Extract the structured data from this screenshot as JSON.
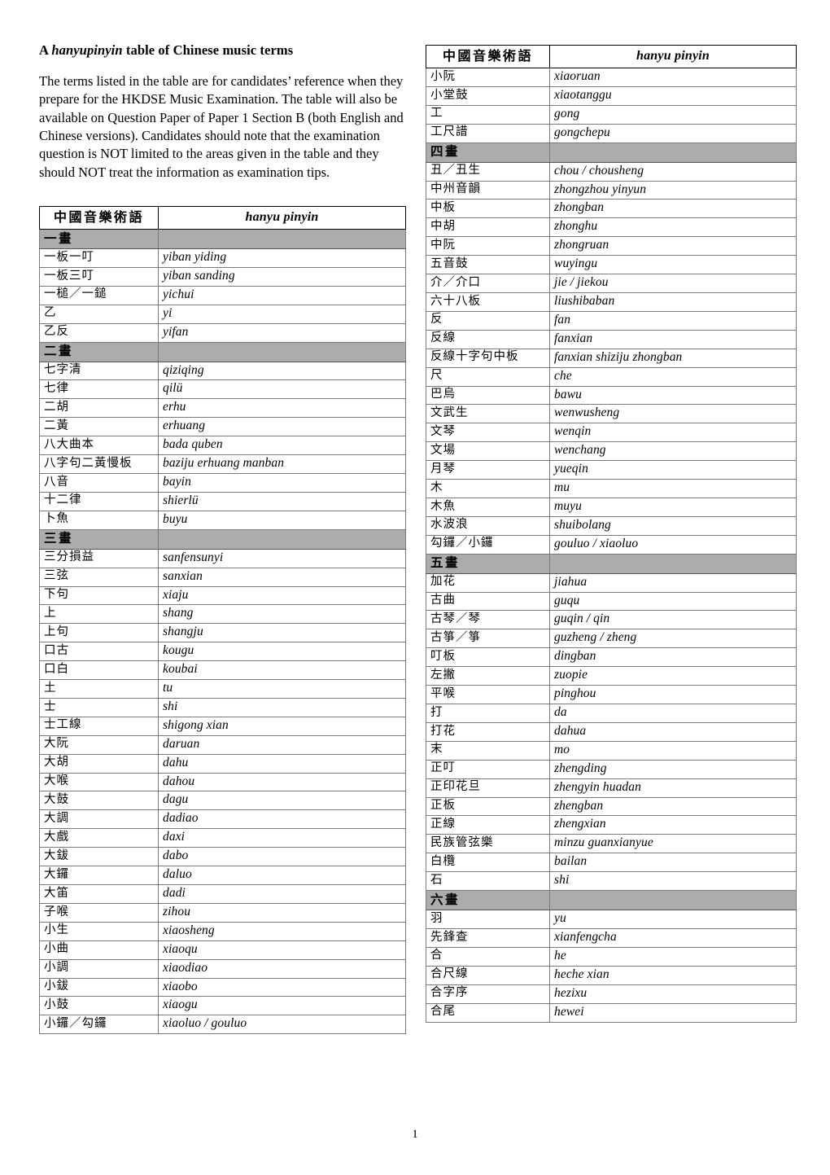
{
  "document": {
    "title_prefix": "A ",
    "title_italic": "hanyupinyin",
    "title_suffix": " table of Chinese music terms",
    "intro": "The terms listed in the table are for candidates’ reference when they prepare for the HKDSE Music Examination. The table will also be available on Question Paper of Paper 1 Section B (both English and Chinese versions). Candidates should note that the examination question is NOT limited to the areas given in the table and they should NOT treat the information as examination tips.",
    "page_number": "1"
  },
  "table_header": {
    "chinese": "中國音樂術語",
    "pinyin": "hanyu pinyin"
  },
  "left_table": {
    "rows": [
      {
        "type": "section",
        "zh": "一畫",
        "py": ""
      },
      {
        "type": "entry",
        "zh": "一板一叮",
        "py": "yiban yiding"
      },
      {
        "type": "entry",
        "zh": "一板三叮",
        "py": "yiban sanding"
      },
      {
        "type": "entry",
        "zh": "一槌／一鎚",
        "py": "yichui"
      },
      {
        "type": "entry",
        "zh": "乙",
        "py": "yi"
      },
      {
        "type": "entry",
        "zh": "乙反",
        "py": "yifan"
      },
      {
        "type": "section",
        "zh": "二畫",
        "py": ""
      },
      {
        "type": "entry",
        "zh": "七字清",
        "py": "qiziqing"
      },
      {
        "type": "entry",
        "zh": "七律",
        "py": "qilü"
      },
      {
        "type": "entry",
        "zh": "二胡",
        "py": "erhu"
      },
      {
        "type": "entry",
        "zh": "二黃",
        "py": "erhuang"
      },
      {
        "type": "entry",
        "zh": "八大曲本",
        "py": "bada quben"
      },
      {
        "type": "entry",
        "zh": "八字句二黃慢板",
        "py": "baziju erhuang manban"
      },
      {
        "type": "entry",
        "zh": "八音",
        "py": "bayin"
      },
      {
        "type": "entry",
        "zh": "十二律",
        "py": "shierlü"
      },
      {
        "type": "entry",
        "zh": "卜魚",
        "py": "buyu"
      },
      {
        "type": "section",
        "zh": "三畫",
        "py": ""
      },
      {
        "type": "entry",
        "zh": "三分損益",
        "py": "sanfensunyi"
      },
      {
        "type": "entry",
        "zh": "三弦",
        "py": "sanxian"
      },
      {
        "type": "entry",
        "zh": "下句",
        "py": "xiaju"
      },
      {
        "type": "entry",
        "zh": "上",
        "py": "shang"
      },
      {
        "type": "entry",
        "zh": "上句",
        "py": "shangju"
      },
      {
        "type": "entry",
        "zh": "口古",
        "py": "kougu"
      },
      {
        "type": "entry",
        "zh": "口白",
        "py": "koubai"
      },
      {
        "type": "entry",
        "zh": "土",
        "py": "tu"
      },
      {
        "type": "entry",
        "zh": "士",
        "py": "shi"
      },
      {
        "type": "entry",
        "zh": "士工線",
        "py": "shigong xian"
      },
      {
        "type": "entry",
        "zh": "大阮",
        "py": "daruan"
      },
      {
        "type": "entry",
        "zh": "大胡",
        "py": "dahu"
      },
      {
        "type": "entry",
        "zh": "大喉",
        "py": "dahou"
      },
      {
        "type": "entry",
        "zh": "大鼓",
        "py": "dagu"
      },
      {
        "type": "entry",
        "zh": "大調",
        "py": "dadiao"
      },
      {
        "type": "entry",
        "zh": "大戲",
        "py": "daxi"
      },
      {
        "type": "entry",
        "zh": "大鈸",
        "py": "dabo"
      },
      {
        "type": "entry",
        "zh": "大鑼",
        "py": "daluo"
      },
      {
        "type": "entry",
        "zh": "大笛",
        "py": "dadi"
      },
      {
        "type": "entry",
        "zh": "子喉",
        "py": "zihou"
      },
      {
        "type": "entry",
        "zh": "小生",
        "py": "xiaosheng"
      },
      {
        "type": "entry",
        "zh": "小曲",
        "py": "xiaoqu"
      },
      {
        "type": "entry",
        "zh": "小調",
        "py": "xiaodiao"
      },
      {
        "type": "entry",
        "zh": "小鈸",
        "py": "xiaobo"
      },
      {
        "type": "entry",
        "zh": "小鼓",
        "py": "xiaogu"
      },
      {
        "type": "entry",
        "zh": "小鑼／勾鑼",
        "py": "xiaoluo / gouluo"
      }
    ]
  },
  "right_table": {
    "rows": [
      {
        "type": "entry",
        "zh": "小阮",
        "py": "xiaoruan"
      },
      {
        "type": "entry",
        "zh": "小堂鼓",
        "py": "xiaotanggu"
      },
      {
        "type": "entry",
        "zh": "工",
        "py": "gong"
      },
      {
        "type": "entry",
        "zh": "工尺譜",
        "py": "gongchepu"
      },
      {
        "type": "section",
        "zh": "四畫",
        "py": ""
      },
      {
        "type": "entry",
        "zh": "丑／丑生",
        "py": "chou / chousheng"
      },
      {
        "type": "entry",
        "zh": "中州音韻",
        "py": "zhongzhou yinyun"
      },
      {
        "type": "entry",
        "zh": "中板",
        "py": "zhongban"
      },
      {
        "type": "entry",
        "zh": "中胡",
        "py": "zhonghu"
      },
      {
        "type": "entry",
        "zh": "中阮",
        "py": "zhongruan"
      },
      {
        "type": "entry",
        "zh": "五音鼓",
        "py": "wuyingu"
      },
      {
        "type": "entry",
        "zh": "介／介口",
        "py": "jie / jiekou"
      },
      {
        "type": "entry",
        "zh": "六十八板",
        "py": "liushibaban"
      },
      {
        "type": "entry",
        "zh": "反",
        "py": "fan"
      },
      {
        "type": "entry",
        "zh": "反線",
        "py": "fanxian"
      },
      {
        "type": "entry",
        "zh": "反線十字句中板",
        "py": "fanxian shiziju zhongban"
      },
      {
        "type": "entry",
        "zh": "尺",
        "py": "che"
      },
      {
        "type": "entry",
        "zh": "巴烏",
        "py": "bawu"
      },
      {
        "type": "entry",
        "zh": "文武生",
        "py": "wenwusheng"
      },
      {
        "type": "entry",
        "zh": "文琴",
        "py": "wenqin"
      },
      {
        "type": "entry",
        "zh": "文場",
        "py": "wenchang"
      },
      {
        "type": "entry",
        "zh": "月琴",
        "py": "yueqin"
      },
      {
        "type": "entry",
        "zh": "木",
        "py": "mu"
      },
      {
        "type": "entry",
        "zh": "木魚",
        "py": "muyu"
      },
      {
        "type": "entry",
        "zh": "水波浪",
        "py": "shuibolang"
      },
      {
        "type": "entry",
        "zh": "勾鑼／小鑼",
        "py": "gouluo / xiaoluo"
      },
      {
        "type": "section",
        "zh": "五畫",
        "py": ""
      },
      {
        "type": "entry",
        "zh": "加花",
        "py": "jiahua"
      },
      {
        "type": "entry",
        "zh": "古曲",
        "py": "guqu"
      },
      {
        "type": "entry",
        "zh": "古琴／琴",
        "py": "guqin / qin"
      },
      {
        "type": "entry",
        "zh": "古箏／箏",
        "py": "guzheng / zheng"
      },
      {
        "type": "entry",
        "zh": "叮板",
        "py": "dingban"
      },
      {
        "type": "entry",
        "zh": "左撇",
        "py": "zuopie"
      },
      {
        "type": "entry",
        "zh": "平喉",
        "py": "pinghou"
      },
      {
        "type": "entry",
        "zh": "打",
        "py": "da"
      },
      {
        "type": "entry",
        "zh": "打花",
        "py": "dahua"
      },
      {
        "type": "entry",
        "zh": "末",
        "py": "mo"
      },
      {
        "type": "entry",
        "zh": "正叮",
        "py": "zhengding"
      },
      {
        "type": "entry",
        "zh": "正印花旦",
        "py": "zhengyin huadan"
      },
      {
        "type": "entry",
        "zh": "正板",
        "py": "zhengban"
      },
      {
        "type": "entry",
        "zh": "正線",
        "py": "zhengxian"
      },
      {
        "type": "entry",
        "zh": "民族管弦樂",
        "py": "minzu guanxianyue"
      },
      {
        "type": "entry",
        "zh": "白欖",
        "py": "bailan"
      },
      {
        "type": "entry",
        "zh": "石",
        "py": "shi"
      },
      {
        "type": "section",
        "zh": "六畫",
        "py": ""
      },
      {
        "type": "entry",
        "zh": "羽",
        "py": "yu"
      },
      {
        "type": "entry",
        "zh": "先鋒查",
        "py": "xianfengcha"
      },
      {
        "type": "entry",
        "zh": "合",
        "py": "he"
      },
      {
        "type": "entry",
        "zh": "合尺線",
        "py": "heche xian"
      },
      {
        "type": "entry",
        "zh": "合字序",
        "py": "hezixu"
      },
      {
        "type": "entry",
        "zh": "合尾",
        "py": "hewei"
      }
    ]
  },
  "colors": {
    "section_background": "#acacac",
    "border": "#7a7a7a",
    "outer_border": "#000000",
    "text": "#000000"
  }
}
